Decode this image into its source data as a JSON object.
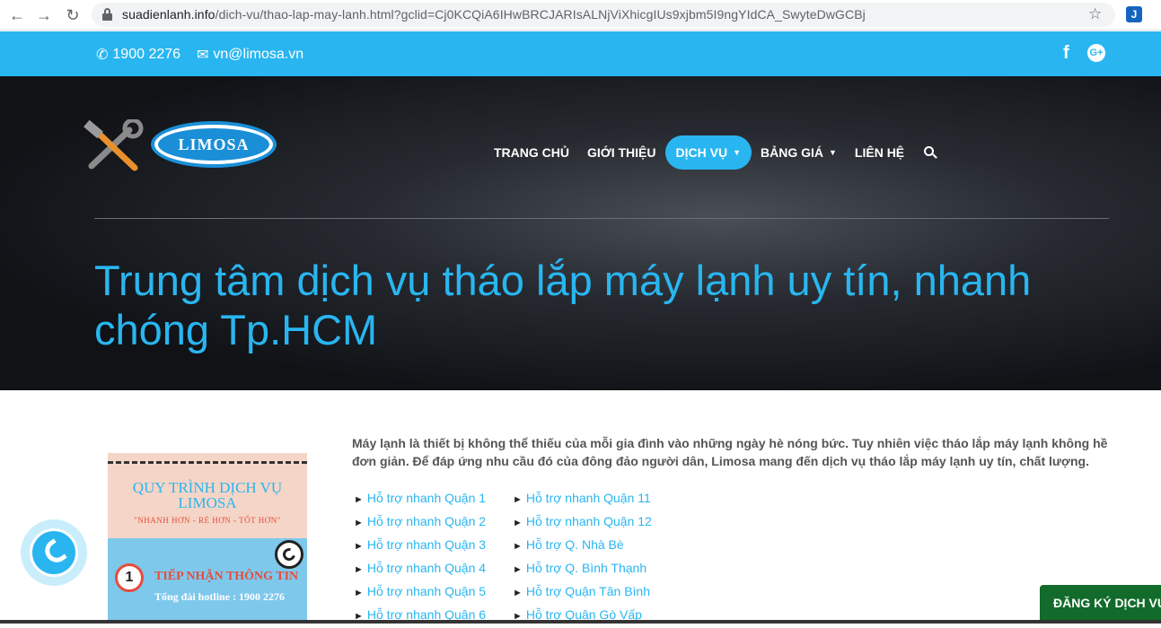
{
  "browser": {
    "url_host": "suadienlanh.info",
    "url_path": "/dich-vu/thao-lap-may-lanh.html?gclid=Cj0KCQiA6IHwBRCJARIsALNjViXhicgIUs9xjbm5I9ngYIdCA_SwyteDwGCBj"
  },
  "topbar": {
    "phone": "1900 2276",
    "email": "vn@limosa.vn"
  },
  "logo": {
    "text": "LIMOSA"
  },
  "menu": {
    "items": [
      {
        "label": "TRANG CHỦ"
      },
      {
        "label": "GIỚI THIỆU"
      },
      {
        "label": "DỊCH VỤ"
      },
      {
        "label": "BẢNG GIÁ"
      },
      {
        "label": "LIÊN HỆ"
      }
    ]
  },
  "hero": {
    "title": "Trung tâm dịch vụ tháo lắp máy lạnh uy tín, nhanh chóng Tp.HCM"
  },
  "banner": {
    "title": "QUY TRÌNH DỊCH VỤ LIMOSA",
    "slogan": "\"NHANH HƠN - RẺ HƠN - TỐT HƠN\"",
    "step_number": "1",
    "step_title": "TIẾP NHẬN THÔNG TIN",
    "hotline": "Tổng đài hotline : 1900 2276"
  },
  "content": {
    "intro": "Máy lạnh là thiết bị không thể thiếu của mỗi gia đình vào những ngày hè nóng bức. Tuy nhiên việc tháo lắp máy lạnh không hề đơn giản. Để đáp ứng nhu cầu đó của đông đảo người dân, Limosa mang đến dịch vụ tháo lắp máy lạnh uy tín, chất lượng.",
    "links_col1": [
      "Hỗ trợ nhanh Quận 1",
      "Hỗ trợ nhanh Quận 2",
      "Hỗ trợ nhanh Quận 3",
      "Hỗ trợ nhanh Quận 4",
      "Hỗ trợ nhanh Quận 5",
      "Hỗ trợ nhanh Quận 6"
    ],
    "links_col2": [
      "Hỗ trợ nhanh Quận 11",
      "Hỗ trợ nhanh Quận 12",
      "Hỗ trợ Q. Nhà Bè",
      "Hỗ trợ Q. Bình Thạnh",
      "Hỗ trợ Quận Tân Bình",
      "Hỗ trợ Quận Gò Vấp"
    ]
  },
  "register_button": "ĐĂNG KÝ DỊCH VỤ"
}
